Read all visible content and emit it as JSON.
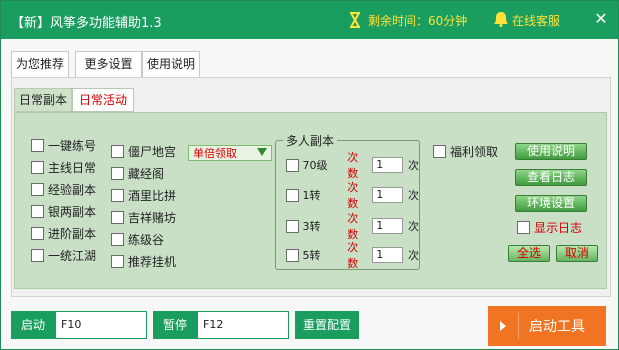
{
  "titlebar": {
    "title": "【新】风筝多功能辅助1.3",
    "remaining_time": "剩余时间：60分钟",
    "online_support": "在线客服",
    "close_symbol": "✕"
  },
  "main_tabs": [
    "为您推荐",
    "更多设置",
    "使用说明"
  ],
  "sub_tabs": [
    "日常副本",
    "日常活动"
  ],
  "left_column": [
    "一键练号",
    "主线日常",
    "经验副本",
    "银两副本",
    "进阶副本",
    "一统江湖"
  ],
  "middle_column": [
    "僵尸地宫",
    "藏经阁",
    "酒里比拼",
    "吉祥赌坊",
    "练级谷",
    "推荐挂机"
  ],
  "dropdown": {
    "selected": "单倍领取"
  },
  "multi_dungeon": {
    "title": "多人副本",
    "count_label": "次数",
    "unit": "次",
    "rows": [
      {
        "label": "70级",
        "count": "1"
      },
      {
        "label": "1转",
        "count": "1"
      },
      {
        "label": "3转",
        "count": "1"
      },
      {
        "label": "5转",
        "count": "1"
      }
    ]
  },
  "welfare": "福利领取",
  "right_buttons": {
    "usage": "使用说明",
    "view_log": "查看日志",
    "env_settings": "环境设置",
    "show_log": "显示日志",
    "select_all": "全选",
    "cancel": "取消"
  },
  "bottom": {
    "start_label": "启动",
    "start_key": "F10",
    "pause_label": "暂停",
    "pause_key": "F12",
    "reset": "重置配置",
    "launch": "启动工具"
  },
  "colors": {
    "title_green": "#1a9e60",
    "panel_green": "#c9e0c7",
    "accent_orange": "#f07422",
    "red_text": "#d20000",
    "gold_text": "#ffe23a"
  }
}
